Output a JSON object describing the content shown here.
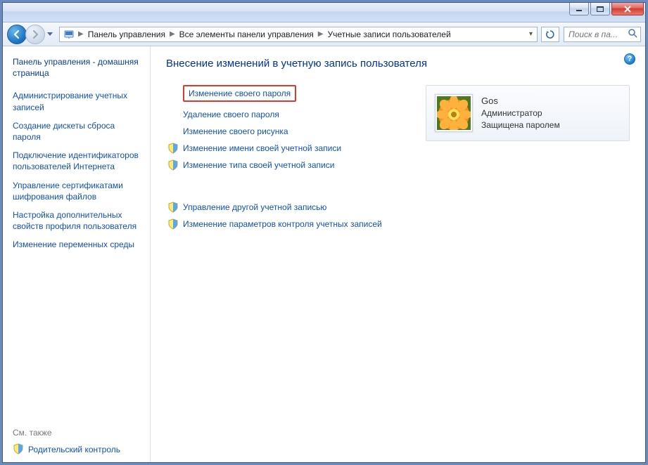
{
  "titlebar": {
    "minimize": "minimize",
    "maximize": "maximize",
    "close": "close"
  },
  "nav": {
    "back": "back",
    "forward": "forward"
  },
  "breadcrumbs": {
    "b0": "Панель управления",
    "b1": "Все элементы панели управления",
    "b2": "Учетные записи пользователей"
  },
  "search": {
    "placeholder": "Поиск в па..."
  },
  "sidebar": {
    "home": "Панель управления - домашняя страница",
    "links": {
      "l0": "Администрирование учетных записей",
      "l1": "Создание дискеты сброса пароля",
      "l2": "Подключение идентификаторов пользователей Интернета",
      "l3": "Управление сертификатами шифрования файлов",
      "l4": "Настройка дополнительных свойств профиля пользователя",
      "l5": "Изменение переменных среды"
    },
    "see_also": "См. также",
    "parental": "Родительский контроль"
  },
  "main": {
    "title": "Внесение изменений в учетную запись пользователя",
    "actions_group1": {
      "a0": "Изменение своего пароля",
      "a1": "Удаление своего пароля",
      "a2": "Изменение своего рисунка",
      "a3": "Изменение имени своей учетной записи",
      "a4": "Изменение типа своей учетной записи"
    },
    "actions_group2": {
      "a0": "Управление другой учетной записью",
      "a1": "Изменение параметров контроля учетных записей"
    },
    "user": {
      "name": "Gos",
      "role": "Администратор",
      "status": "Защищена паролем"
    },
    "help": "?"
  }
}
